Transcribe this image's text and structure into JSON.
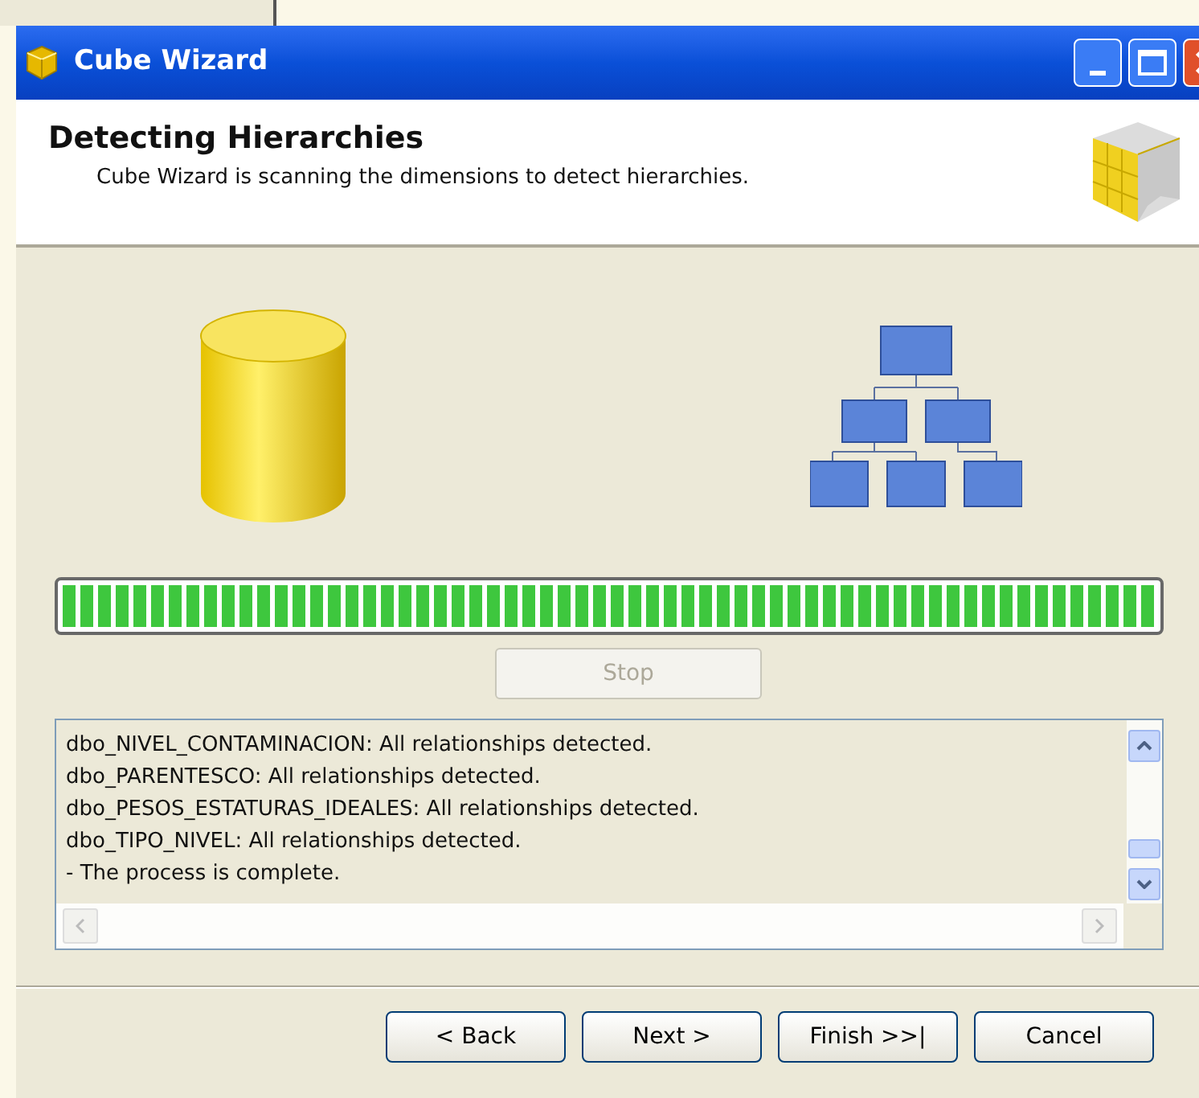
{
  "window": {
    "title": "Cube Wizard"
  },
  "header": {
    "title": "Detecting Hierarchies",
    "subtitle": "Cube Wizard is scanning the dimensions to detect hierarchies."
  },
  "progress": {
    "level": 1.0
  },
  "stop_button": {
    "label": "Stop",
    "disabled": true
  },
  "log": {
    "lines": [
      "dbo_NIVEL_CONTAMINACION: All relationships detected.",
      "dbo_PARENTESCO: All relationships detected.",
      "dbo_PESOS_ESTATURAS_IDEALES: All relationships detected.",
      "dbo_TIPO_NIVEL: All relationships detected.",
      "- The process is complete."
    ]
  },
  "buttons": [
    {
      "label": "< Back",
      "disabled": false
    },
    {
      "label": "Next >",
      "disabled": false
    },
    {
      "label": "Finish >>|",
      "disabled": false
    },
    {
      "label": "Cancel",
      "disabled": false
    }
  ]
}
